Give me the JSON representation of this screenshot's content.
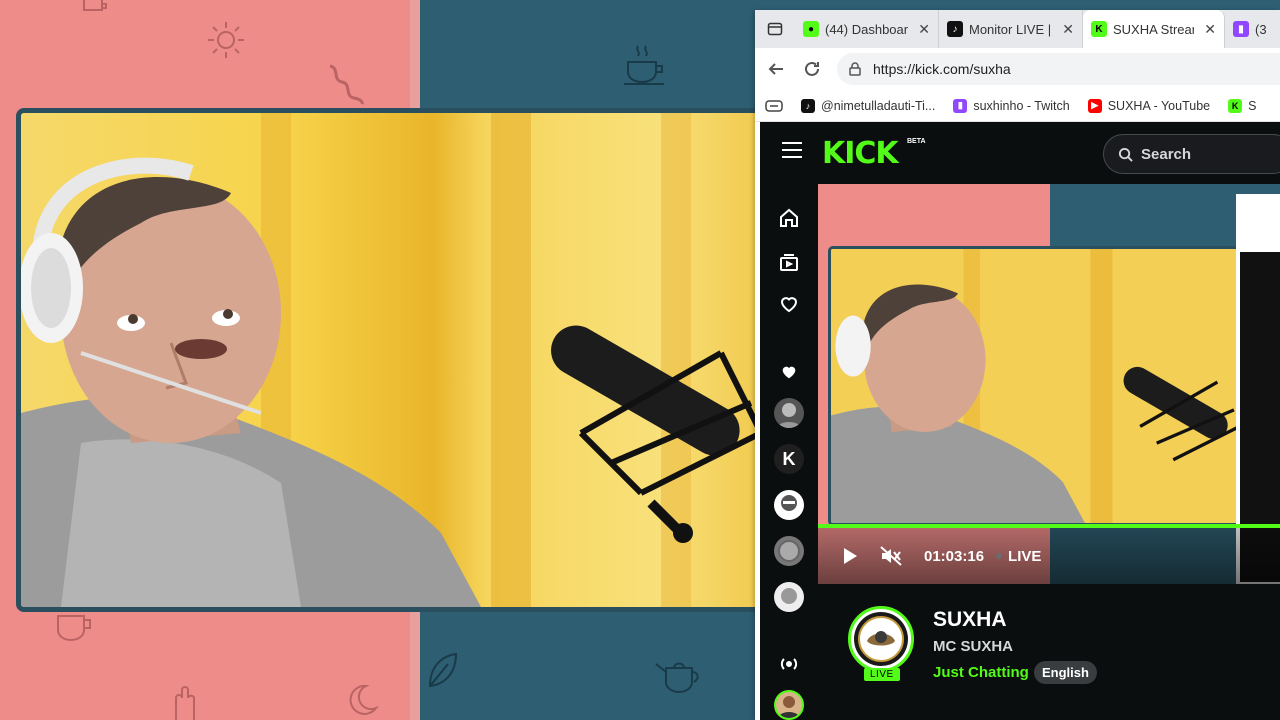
{
  "browser": {
    "tabs": [
      {
        "label": "(44) Dashboar",
        "icon": "kick-dashboard-icon",
        "active": false
      },
      {
        "label": "Monitor LIVE |",
        "icon": "tiktok-icon",
        "active": false
      },
      {
        "label": "SUXHA Stream",
        "icon": "kick-icon",
        "active": true
      },
      {
        "label": "(3",
        "icon": "twitch-icon",
        "active": false
      }
    ],
    "url": "https://kick.com/suxha",
    "bookmarks": [
      {
        "label": "@nimetulladauti-Ti...",
        "icon": "tiktok-icon"
      },
      {
        "label": "suxhinho - Twitch",
        "icon": "twitch-icon"
      },
      {
        "label": "SUXHA - YouTube",
        "icon": "youtube-icon"
      },
      {
        "label": "S",
        "icon": "kick-icon"
      }
    ]
  },
  "kick": {
    "logo": "KICK",
    "beta": "BETA",
    "search_label": "Search",
    "player": {
      "time": "01:03:16",
      "live_label": "LIVE"
    },
    "channel": {
      "name": "SUXHA",
      "title": "MC SUXHA",
      "category": "Just Chatting",
      "language": "English",
      "live_badge": "LIVE",
      "avatar_text": "SUXHA"
    }
  },
  "colors": {
    "kick_green": "#53fc18",
    "pink_bg": "#ee8c8a",
    "teal_bg": "#2e5e71",
    "kick_dark": "#0b0e0f"
  }
}
